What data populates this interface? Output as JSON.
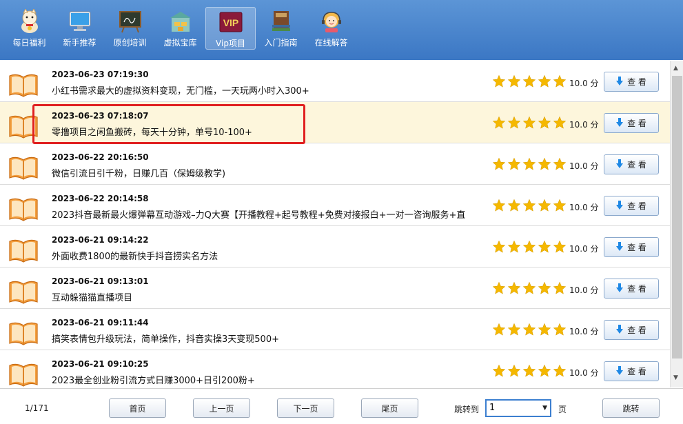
{
  "toolbar": {
    "items": [
      {
        "label": "每日福利",
        "icon": "lucky-cat-icon"
      },
      {
        "label": "新手推荐",
        "icon": "monitor-icon"
      },
      {
        "label": "原创培训",
        "icon": "chalkboard-icon"
      },
      {
        "label": "虚拟宝库",
        "icon": "warehouse-icon"
      },
      {
        "label": "Vip项目",
        "icon": "vip-badge-icon",
        "badge": "VIP"
      },
      {
        "label": "入门指南",
        "icon": "books-icon"
      },
      {
        "label": "在线解答",
        "icon": "support-agent-icon"
      }
    ]
  },
  "list": {
    "rows": [
      {
        "date": "2023-06-23 07:19:30",
        "title": "小红书需求最大的虚拟资料变现，无门槛，一天玩两小时入300+",
        "score": "10.0 分",
        "stars": 5,
        "button": "查 看"
      },
      {
        "date": "2023-06-23 07:18:07",
        "title": "零撸项目之闲鱼搬砖，每天十分钟，单号10-100+",
        "score": "10.0 分",
        "stars": 5,
        "button": "查 看"
      },
      {
        "date": "2023-06-22 20:16:50",
        "title": "微信引流日引千粉，日赚几百（保姆级教学)",
        "score": "10.0 分",
        "stars": 5,
        "button": "查 看"
      },
      {
        "date": "2023-06-22 20:14:58",
        "title": "2023抖音最新最火爆弹幕互动游戏–力Q大赛【开播教程+起号教程+免费对接报白+一对一咨询服务+直",
        "score": "10.0 分",
        "stars": 5,
        "button": "查 看"
      },
      {
        "date": "2023-06-21 09:14:22",
        "title": "外面收费1800的最新快手抖音捞实名方法",
        "score": "10.0 分",
        "stars": 5,
        "button": "查 看"
      },
      {
        "date": "2023-06-21 09:13:01",
        "title": "互动躲猫猫直播项目",
        "score": "10.0 分",
        "stars": 5,
        "button": "查 看"
      },
      {
        "date": "2023-06-21 09:11:44",
        "title": "搞笑表情包升级玩法，简单操作，抖音实操3天变现500+",
        "score": "10.0 分",
        "stars": 5,
        "button": "查 看"
      },
      {
        "date": "2023-06-21 09:10:25",
        "title": "2023最全创业粉引流方式日赚3000+日引200粉+",
        "score": "10.0 分",
        "stars": 5,
        "button": "查 看"
      }
    ]
  },
  "footer": {
    "page_indicator": "1/171",
    "first": "首页",
    "prev": "上一页",
    "next": "下一页",
    "last": "尾页",
    "jump_label": "跳转到",
    "jump_value": "1",
    "page_unit": "页",
    "jump_button": "跳转"
  },
  "colors": {
    "toolbar": "#4a86cc",
    "highlight_row": "#fdf6dc",
    "star": "#f5b800",
    "annotation_box": "#e02020",
    "download_arrow": "#1e88e5"
  }
}
